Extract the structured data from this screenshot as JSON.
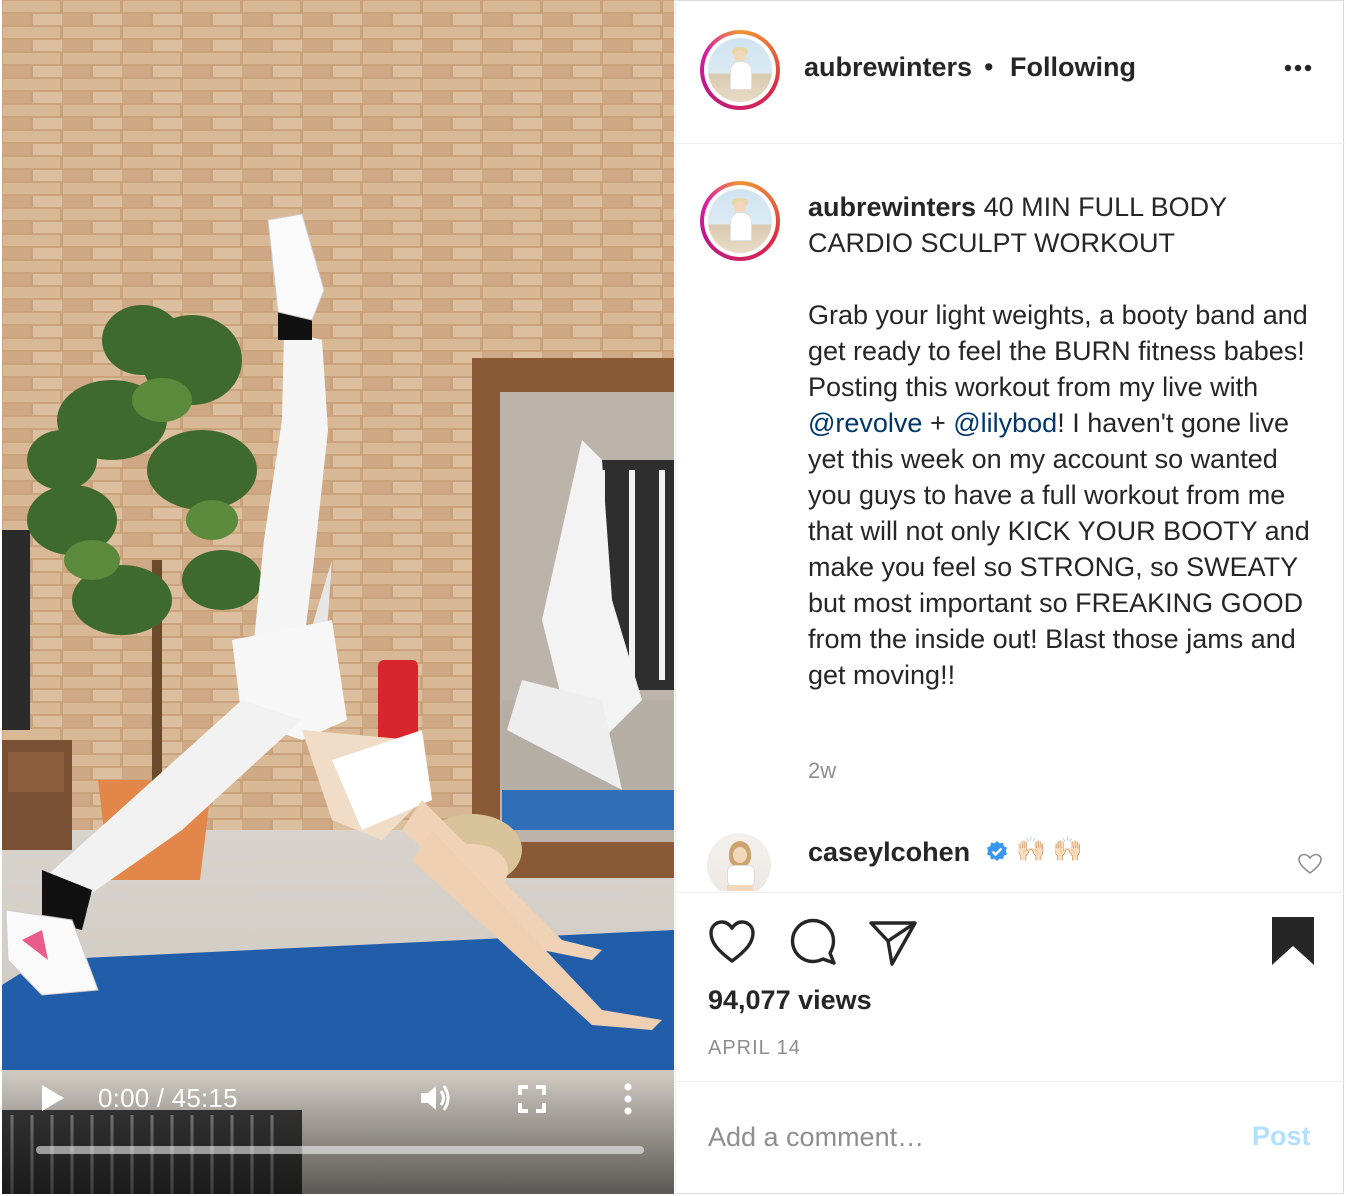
{
  "video": {
    "time_display": "0:00 / 45:15",
    "progress": 0,
    "icons": [
      "play-icon",
      "volume-icon",
      "fullscreen-icon",
      "more-vertical-icon"
    ]
  },
  "post": {
    "username": "aubrewinters",
    "separator": "•",
    "follow_status": "Following",
    "caption": {
      "username": "aubrewinters",
      "title": " 40 MIN FULL BODY CARDIO SCULPT WORKOUT",
      "body_part1": "Grab your light weights, a booty band and get ready to feel the BURN fitness babes! Posting this workout from my live with ",
      "mention1": "@revolve",
      "plus": " + ",
      "mention2": "@lilybod",
      "body_part2": "! I haven't gone live yet this week on my account so wanted you guys to have a full workout from me that will not only KICK YOUR BOOTY and make you feel so STRONG, so SWEATY but most important so FREAKING GOOD from the inside out! Blast those jams and get moving!!",
      "time_ago": "2w"
    },
    "comment": {
      "username": "caseylcohen",
      "text": "🙌🏻 🙌🏻",
      "verified": true
    },
    "views": "94,077 views",
    "date": "APRIL 14",
    "add_comment_placeholder": "Add a comment…",
    "post_label": "Post"
  },
  "colors": {
    "link": "#00376b",
    "muted": "#8e8e8e",
    "post_disabled": "#b2dffc",
    "verified": "#3897f0"
  }
}
